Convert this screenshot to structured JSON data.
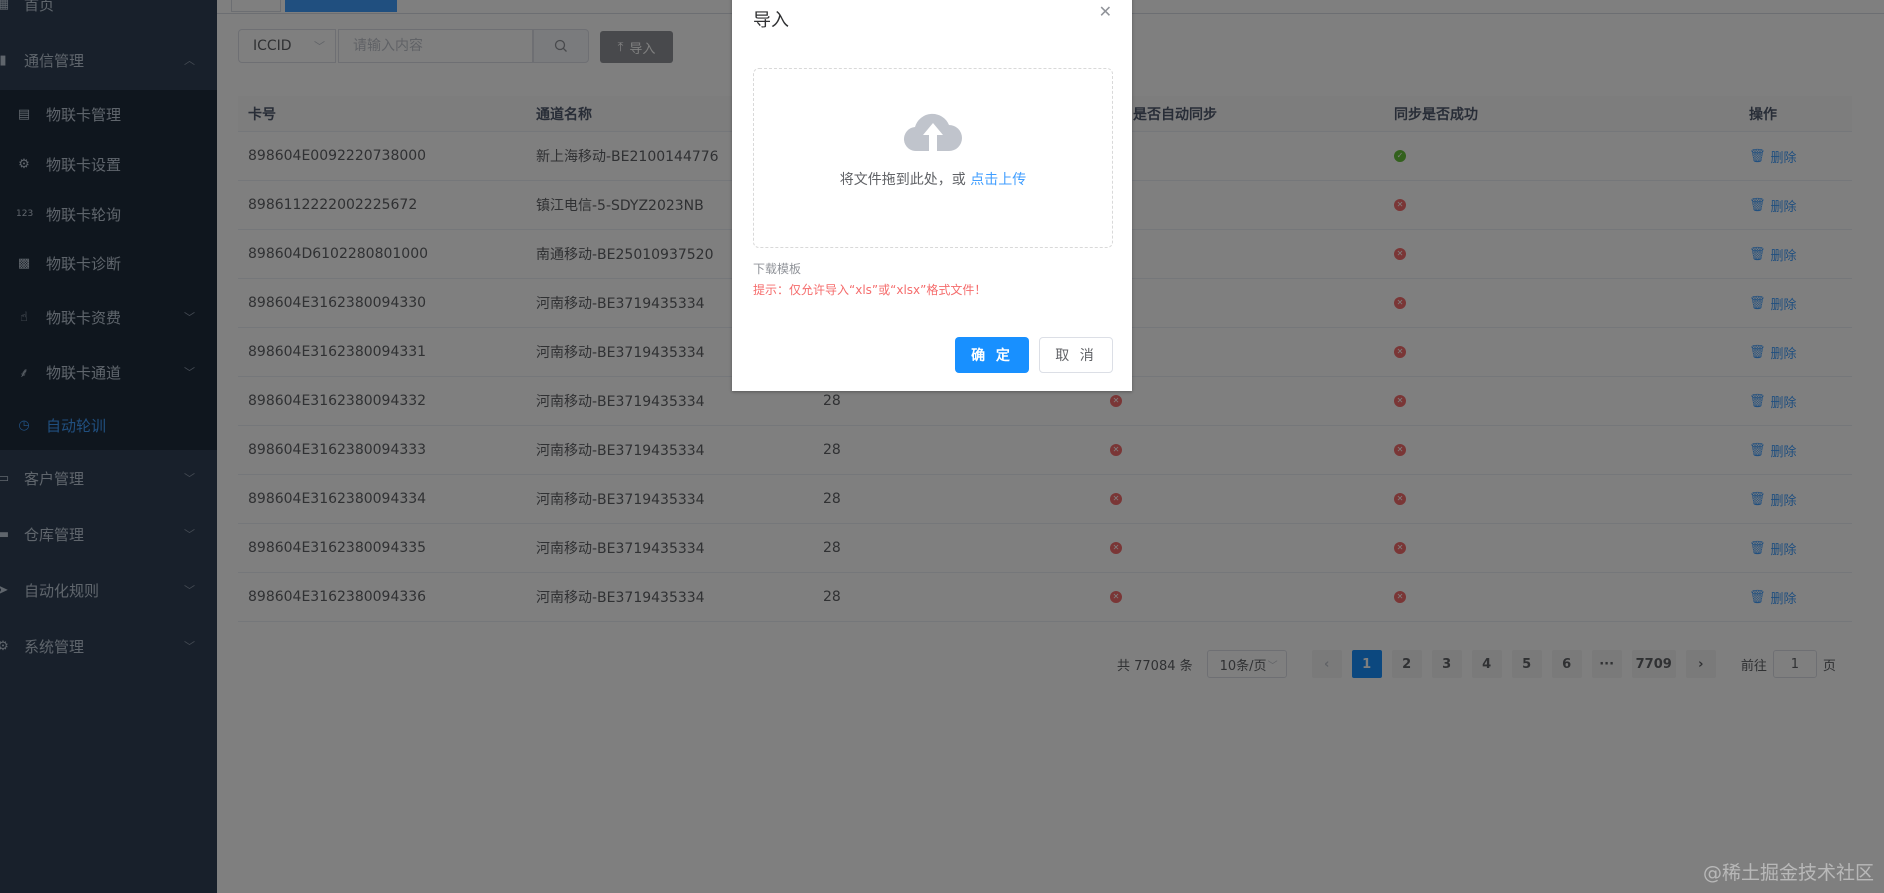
{
  "sidebar": {
    "home": "首页",
    "comm": "通信管理",
    "sub": [
      "物联卡管理",
      "物联卡设置",
      "物联卡轮询",
      "物联卡诊断",
      "物联卡资费",
      "物联卡通道",
      "自动轮训"
    ],
    "customer": "客户管理",
    "warehouse": "仓库管理",
    "automation": "自动化规则",
    "system": "系统管理"
  },
  "search": {
    "select_value": "ICCID",
    "placeholder": "请输入内容",
    "import_label": "导入"
  },
  "table": {
    "headers": [
      "卡号",
      "通道名称",
      "",
      "是否自动同步",
      "同步是否成功",
      "操作"
    ],
    "delete_label": "删除",
    "rows": [
      {
        "card": "898604E0092220738000",
        "channel": "新上海移动-BE2100144776",
        "c3": null,
        "auto": null,
        "success": true
      },
      {
        "card": "8986112222002225672",
        "channel": "镇江电信-5-SDYZ2023NB",
        "c3": null,
        "auto": null,
        "success": false
      },
      {
        "card": "898604D6102280801000",
        "channel": "南通移动-BE25010937520",
        "c3": null,
        "auto": null,
        "success": false
      },
      {
        "card": "898604E3162380094330",
        "channel": "河南移动-BE3719435334",
        "c3": null,
        "auto": null,
        "success": false
      },
      {
        "card": "898604E3162380094331",
        "channel": "河南移动-BE3719435334",
        "c3": null,
        "auto": null,
        "success": false
      },
      {
        "card": "898604E3162380094332",
        "channel": "河南移动-BE3719435334",
        "c3": "28",
        "auto": false,
        "success": false
      },
      {
        "card": "898604E3162380094333",
        "channel": "河南移动-BE3719435334",
        "c3": "28",
        "auto": false,
        "success": false
      },
      {
        "card": "898604E3162380094334",
        "channel": "河南移动-BE3719435334",
        "c3": "28",
        "auto": false,
        "success": false
      },
      {
        "card": "898604E3162380094335",
        "channel": "河南移动-BE3719435334",
        "c3": "28",
        "auto": false,
        "success": false
      },
      {
        "card": "898604E3162380094336",
        "channel": "河南移动-BE3719435334",
        "c3": "28",
        "auto": false,
        "success": false
      }
    ]
  },
  "pagination": {
    "total": "共 77084 条",
    "page_size": "10条/页",
    "pages": [
      "1",
      "2",
      "3",
      "4",
      "5",
      "6",
      "···",
      "7709"
    ],
    "current": 1,
    "goto_label": "前往",
    "goto_value": "1",
    "page_suffix": "页"
  },
  "modal": {
    "title": "导入",
    "drop_text": "将文件拖到此处，或",
    "upload_link": "点击上传",
    "template_link": "下载模板",
    "tip": "提示：仅允许导入“xls”或“xlsx”格式文件！",
    "confirm": "确 定",
    "cancel": "取 消"
  },
  "watermark": "@稀土掘金技术社区",
  "colors": {
    "primary": "#1890ff",
    "danger": "#f56c6c",
    "success": "#67c23a",
    "sidebar": "#304156"
  }
}
